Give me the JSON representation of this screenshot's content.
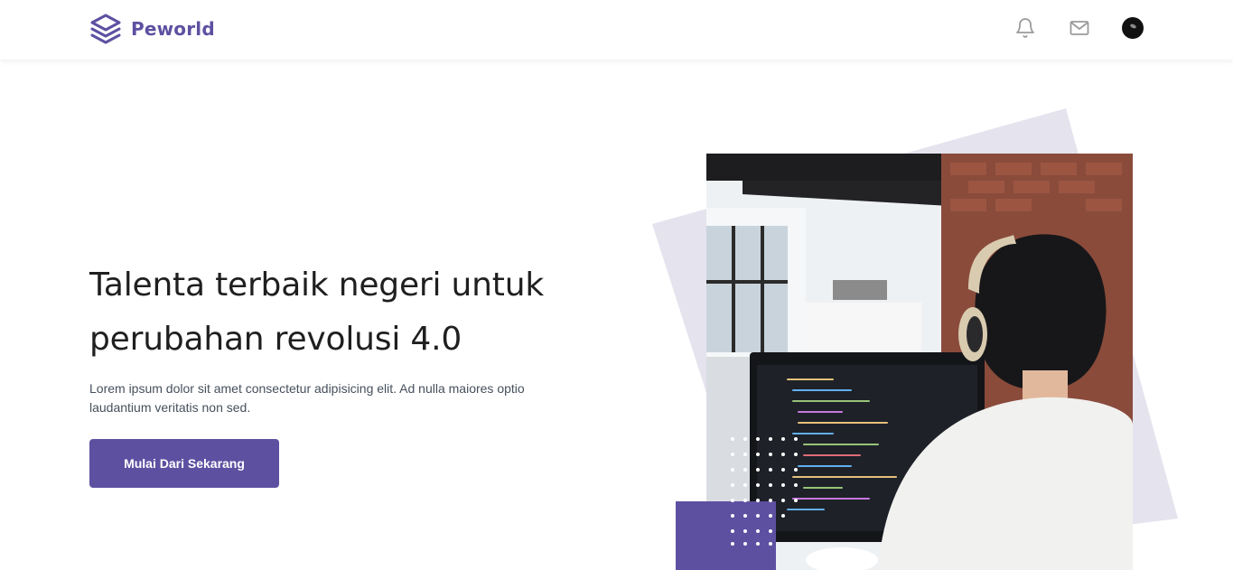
{
  "navbar": {
    "brand_name": "Peworld",
    "icons": [
      "layers-logo-icon",
      "bell-icon",
      "mail-icon",
      "avatar"
    ]
  },
  "hero": {
    "title_line1": "Talenta terbaik negeri untuk",
    "title_line2": "perubahan revolusi 4.0",
    "description": "Lorem ipsum dolor sit amet consectetur adipisicing elit. Ad nulla maiores optio laudantium veritatis non sed.",
    "cta_label": "Mulai Dari Sekarang"
  },
  "colors": {
    "brand": "#5e50a1",
    "shape": "#e4e3ee",
    "text": "#1f1f1f",
    "muted": "#46505c"
  }
}
